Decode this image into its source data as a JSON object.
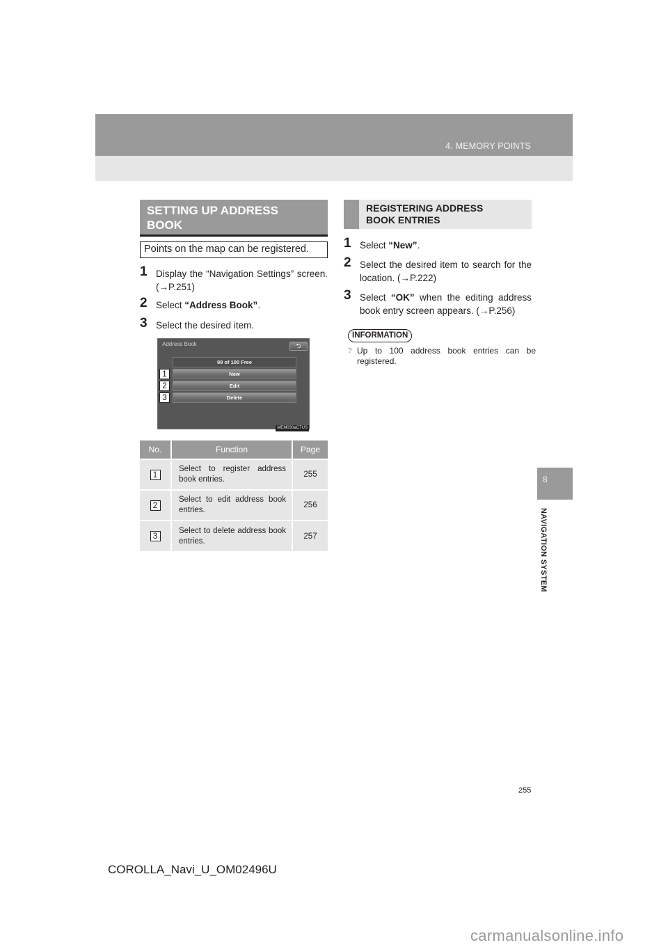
{
  "header": {
    "section_title": "4. MEMORY POINTS"
  },
  "side_tab": {
    "chapter_number": "8",
    "chapter_label": "NAVIGATION SYSTEM"
  },
  "left": {
    "heading": "SETTING UP ADDRESS BOOK",
    "intro": "Points on the map can be registered.",
    "steps": [
      {
        "num": "1",
        "pre": "Display the “Navigation Settings” screen. (→P.251)",
        "bold": "",
        "post": ""
      },
      {
        "num": "2",
        "pre": "Select ",
        "bold": "“Address Book”",
        "post": "."
      },
      {
        "num": "3",
        "pre": "Select the desired item.",
        "bold": "",
        "post": ""
      }
    ],
    "screen": {
      "title": "Address Book",
      "back_icon": "⮌",
      "free_label": "99 of 100 Free",
      "buttons": [
        {
          "num": "1",
          "label": "New"
        },
        {
          "num": "2",
          "label": "Edit"
        },
        {
          "num": "3",
          "label": "Delete"
        }
      ],
      "image_code": "MEM030aCTUS"
    },
    "table": {
      "headers": [
        "No.",
        "Function",
        "Page"
      ],
      "rows": [
        {
          "no": "1",
          "function": "Select to register address book entries.",
          "page": "255"
        },
        {
          "no": "2",
          "function": "Select to edit address book entries.",
          "page": "256"
        },
        {
          "no": "3",
          "function": "Select to delete address book entries.",
          "page": "257"
        }
      ]
    }
  },
  "right": {
    "heading": "REGISTERING ADDRESS BOOK ENTRIES",
    "steps": [
      {
        "num": "1",
        "pre": "Select ",
        "bold": "“New”",
        "post": "."
      },
      {
        "num": "2",
        "pre": "Select the desired item to search for the location. (→P.222)",
        "bold": "",
        "post": ""
      },
      {
        "num": "3",
        "pre": "Select ",
        "bold": "“OK”",
        "post": " when the editing address book entry screen appears. (→P.256)"
      }
    ],
    "information": {
      "label": "INFORMATION",
      "bullet": "?",
      "items": [
        "Up to 100 address book entries can be registered."
      ]
    }
  },
  "footer": {
    "page_number": "255",
    "document_code": "COROLLA_Navi_U_OM02496U",
    "watermark": "carmanualsonline.info"
  }
}
